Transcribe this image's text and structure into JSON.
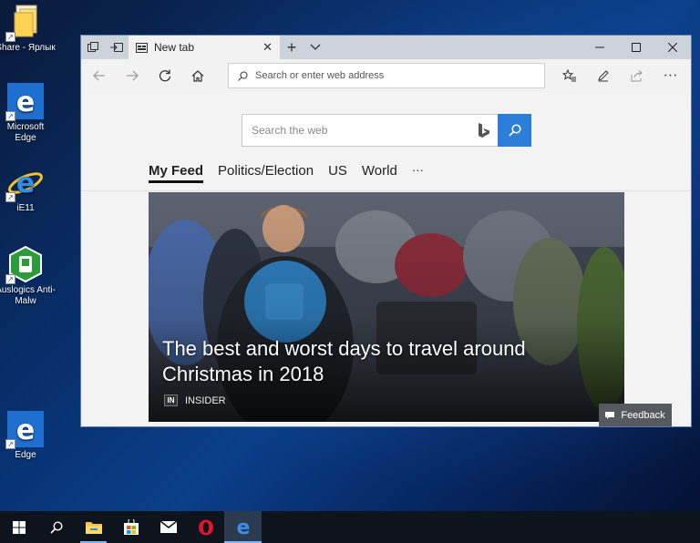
{
  "desktop": {
    "icons": [
      {
        "label": "Share - Ярлык",
        "icon": "folder-icon"
      },
      {
        "label": "Microsoft Edge",
        "icon": "edge-icon"
      },
      {
        "label": "iE11",
        "icon": "ie-icon"
      },
      {
        "label": "Auslogics Anti-Malw",
        "icon": "auslogics-icon"
      },
      {
        "label": "Edge",
        "icon": "edge-icon"
      }
    ]
  },
  "browser": {
    "tab_title": "New tab",
    "address_placeholder": "Search or enter web address",
    "search_placeholder": "Search the web",
    "feed_tabs": [
      "My Feed",
      "Politics/Election",
      "US",
      "World",
      "···"
    ],
    "hero": {
      "title": "The best and worst days to travel around Christmas in 2018",
      "source_badge": "IN",
      "source": "INSIDER"
    },
    "feedback_label": "Feedback"
  },
  "colors": {
    "accent": "#2b7fd8",
    "desktop_bg": "#0a3f8a",
    "taskbar_bg": "#0e141c"
  },
  "taskbar": {
    "items": [
      "start-icon",
      "search-icon",
      "file-explorer-icon",
      "store-icon",
      "mail-icon",
      "opera-icon",
      "edge-icon"
    ]
  }
}
